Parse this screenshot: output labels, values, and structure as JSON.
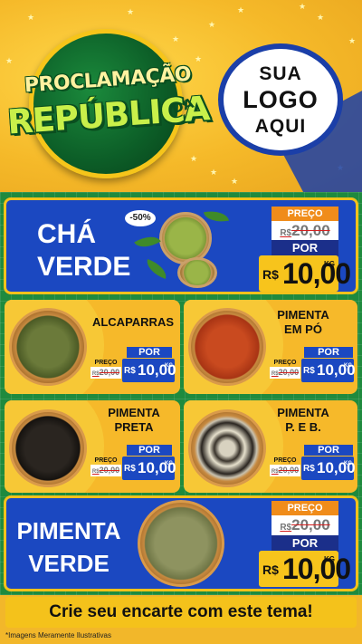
{
  "header": {
    "title_line1": "PROCLAMAÇÃO",
    "title_line2": "REPÚBLICA",
    "title_da": "DA",
    "logo_line1": "SUA",
    "logo_line2": "LOGO",
    "logo_line3": "AQUI"
  },
  "featured_top": {
    "name_line1": "CHÁ",
    "name_line2": "VERDE",
    "discount": "-50%",
    "preco_label": "PREÇO",
    "old_currency": "R$",
    "old_price": "20,00",
    "por_label": "POR",
    "new_currency": "R$",
    "new_price": "10,00",
    "unit": "KG"
  },
  "products": [
    {
      "name": "ALCAPARRAS",
      "preco_label": "PREÇO",
      "old_currency": "R$",
      "old_price": "20,00",
      "por_label": "POR",
      "new_currency": "R$",
      "new_price": "10,00",
      "unit": "KG"
    },
    {
      "name": "PIMENTA EM PÓ",
      "preco_label": "PREÇO",
      "old_currency": "R$",
      "old_price": "20,00",
      "por_label": "POR",
      "new_currency": "R$",
      "new_price": "10,00",
      "unit": "KG"
    },
    {
      "name": "PIMENTA PRETA",
      "preco_label": "PREÇO",
      "old_currency": "R$",
      "old_price": "20,00",
      "por_label": "POR",
      "new_currency": "R$",
      "new_price": "10,00",
      "unit": "KG"
    },
    {
      "name": "PIMENTA P. E B.",
      "preco_label": "PREÇO",
      "old_currency": "R$",
      "old_price": "20,00",
      "por_label": "POR",
      "new_currency": "R$",
      "new_price": "10,00",
      "unit": "KG"
    }
  ],
  "featured_bottom": {
    "name_line1": "PIMENTA",
    "name_line2": "VERDE",
    "preco_label": "PREÇO",
    "old_currency": "R$",
    "old_price": "20,00",
    "por_label": "POR",
    "new_currency": "R$",
    "new_price": "10,00",
    "unit": "KG"
  },
  "footer": {
    "banner": "Crie seu encarte com este tema!",
    "disclaimer": "*Imagens Meramente Ilustrativas"
  },
  "colors": {
    "blue": "#1b48c1",
    "yellow": "#f6b92a",
    "green": "#1f8a3e",
    "orange": "#f08c1a"
  }
}
